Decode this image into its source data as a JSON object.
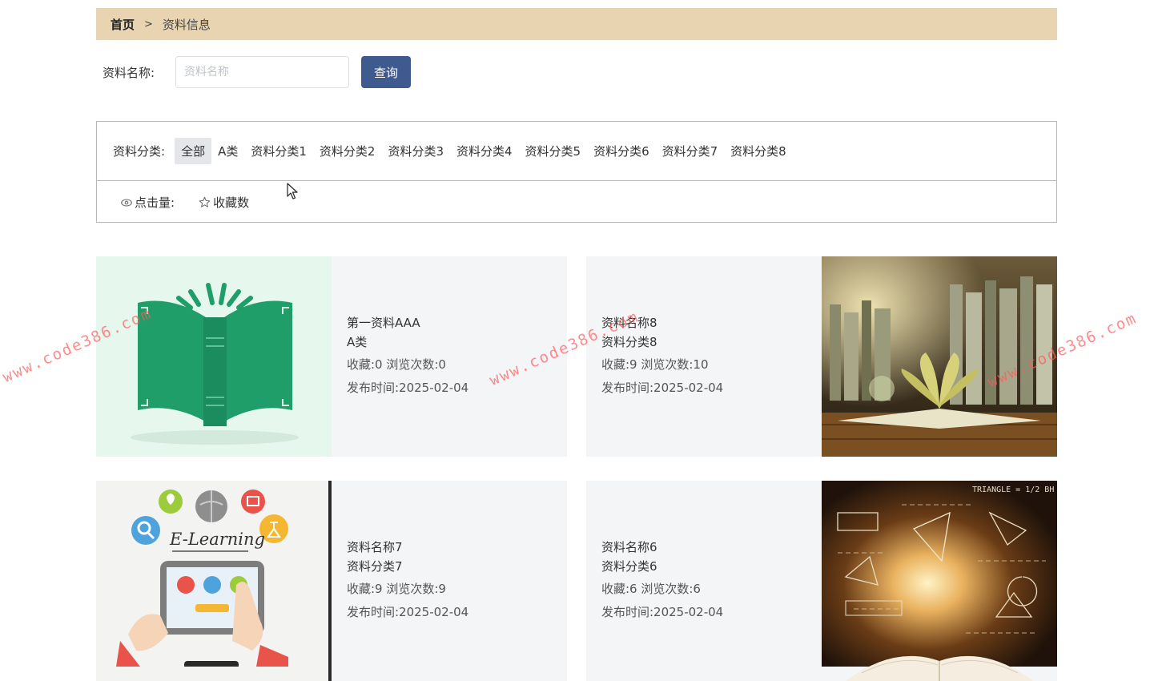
{
  "breadcrumb": {
    "home": "首页",
    "separator": ">",
    "current": "资料信息"
  },
  "search": {
    "label": "资料名称:",
    "placeholder": "资料名称",
    "value": "",
    "button": "查询"
  },
  "categories": {
    "title": "资料分类:",
    "items": [
      "全部",
      "A类",
      "资料分类1",
      "资料分类2",
      "资料分类3",
      "资料分类4",
      "资料分类5",
      "资料分类6",
      "资料分类7",
      "资料分类8"
    ],
    "active_index": 0
  },
  "sort": {
    "clicks_label": "点击量:",
    "favorites_label": "收藏数"
  },
  "cards": [
    {
      "name": "第一资料AAA",
      "category": "A类",
      "stats": "收藏:0  浏览次数:0",
      "date": "发布时间:2025-02-04",
      "image": "green-book"
    },
    {
      "name": "资料名称8",
      "category": "资料分类8",
      "stats": "收藏:9  浏览次数:10",
      "date": "发布时间:2025-02-04",
      "image": "open-book-photo"
    },
    {
      "name": "资料名称7",
      "category": "资料分类7",
      "stats": "收藏:9  浏览次数:9",
      "date": "发布时间:2025-02-04",
      "image": "e-learning",
      "image_text": "E-Learning"
    },
    {
      "name": "资料名称6",
      "category": "资料分类6",
      "stats": "收藏:6  浏览次数:6",
      "date": "发布时间:2025-02-04",
      "image": "math-book-glow",
      "image_text": "TRIANGLE = 1/2 BH"
    }
  ],
  "watermark": "www.code386.com",
  "colors": {
    "breadcrumb_bg": "#e8d4b0",
    "button_bg": "#3f5a8f",
    "card_bg": "#f4f5f7",
    "book_green": "#1f9e6a"
  }
}
